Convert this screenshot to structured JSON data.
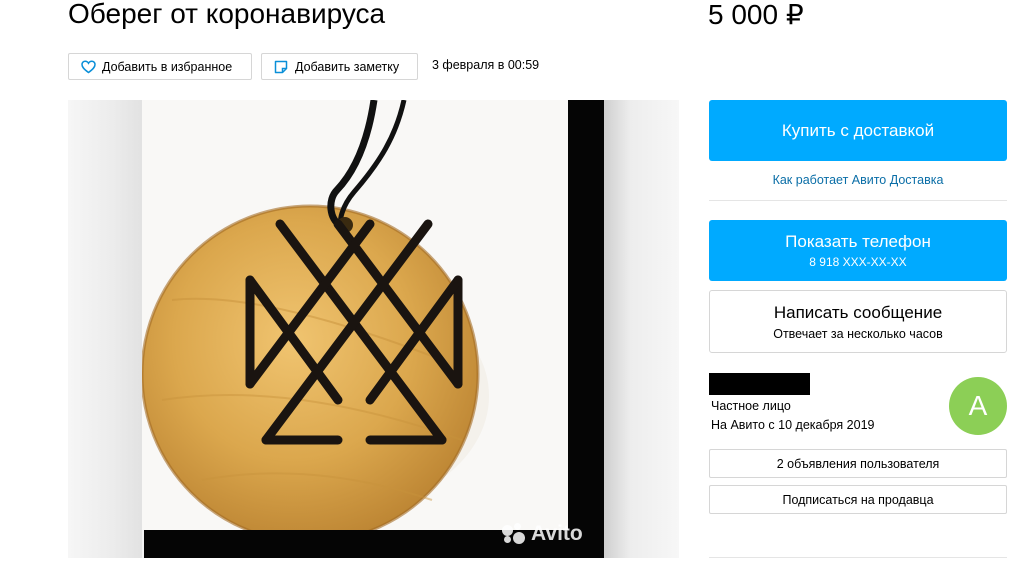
{
  "listing": {
    "title": "Оберег от коронавируса",
    "price": "5 000 ₽",
    "date": "3 февраля в 00:59"
  },
  "actions": {
    "favorite_label": "Добавить в избранное",
    "note_label": "Добавить заметку"
  },
  "gallery": {
    "watermark": "Avito"
  },
  "sidebar": {
    "buy_label": "Купить с доставкой",
    "delivery_link": "Как работает Авито Доставка",
    "phone_label": "Показать телефон",
    "phone_number": "8 918 XXX-XX-XX",
    "message_label": "Написать сообщение",
    "message_sub": "Отвечает за несколько часов"
  },
  "seller": {
    "type": "Частное лицо",
    "since": "На Авито с 10 декабря 2019",
    "avatar_letter": "A",
    "ads_label": "2 объявления пользователя",
    "subscribe_label": "Подписаться на продавца"
  },
  "colors": {
    "accent": "#00aaff",
    "link": "#0a6ea7",
    "avatar": "#8ccf56"
  }
}
